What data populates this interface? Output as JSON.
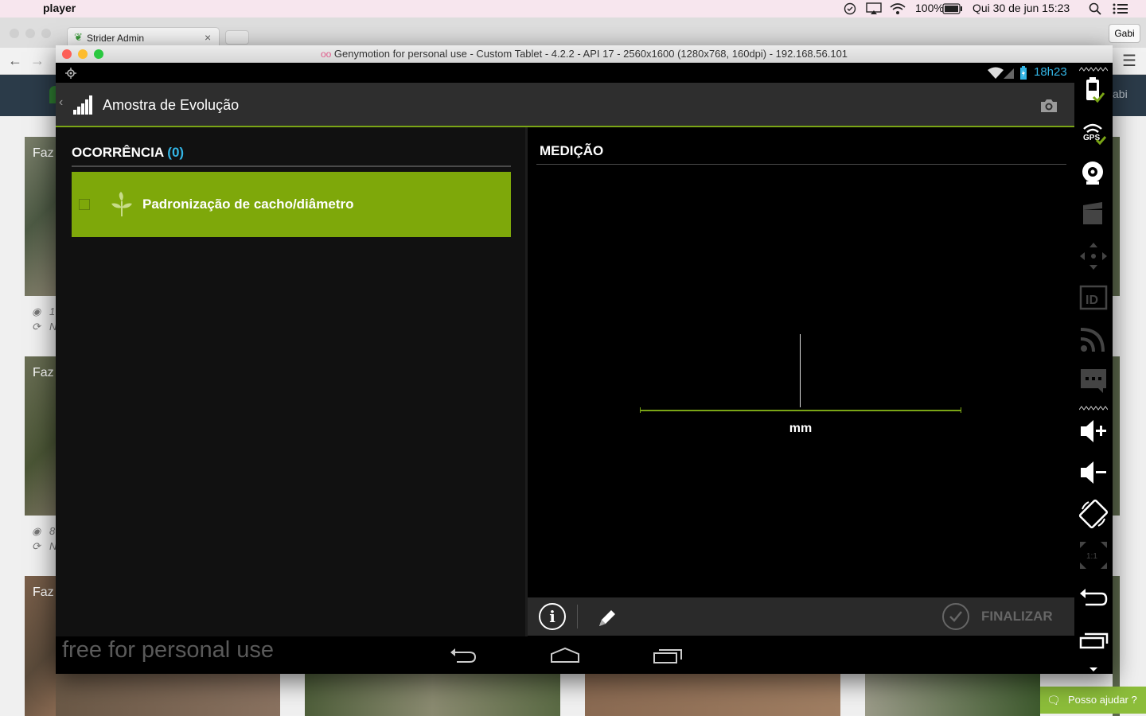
{
  "menubar": {
    "app_name": "player",
    "battery": "100%",
    "datetime": "Qui 30 de jun  15:23"
  },
  "browser": {
    "tab_title": "Strider Admin",
    "profile_button": "Gabi",
    "header_user_fragment": "abi",
    "cards": [
      {
        "title_fragment": "Faz",
        "meta1": "1",
        "meta2": "N"
      },
      {
        "title_fragment": "Faz",
        "meta1": "8",
        "meta2": "N"
      },
      {
        "title_fragment": "Faz"
      }
    ],
    "help_button": "Posso ajudar ?"
  },
  "emulator": {
    "window_title": "Genymotion for personal use - Custom Tablet - 4.2.2 - API 17 - 2560x1600 (1280x768, 160dpi) - 192.168.56.101",
    "status_clock": "18h23",
    "watermark": "free for personal use"
  },
  "app": {
    "title": "Amostra de Evolução",
    "occurrence": {
      "heading": "OCORRÊNCIA",
      "count": "(0)",
      "items": [
        {
          "label": "Padronização de cacho/diâmetro",
          "checked": false
        }
      ]
    },
    "measurement": {
      "heading": "MEDIÇÃO",
      "unit": "mm"
    },
    "toolbar": {
      "finish_label": "FINALIZAR"
    },
    "colors": {
      "accent_green": "#7ea80a",
      "holo_blue": "#33b5e5"
    }
  }
}
